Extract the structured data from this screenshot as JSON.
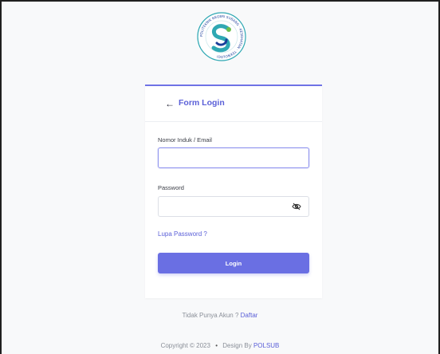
{
  "logo": {
    "ring_text": "POLITEKNIK NEGERI SUBANG · KESEHATAN · TEKNOLOGI",
    "colors": {
      "teal": "#2fa8b3",
      "blue": "#1c3f9b",
      "green": "#6cc04a"
    }
  },
  "form": {
    "title": "Form Login",
    "back_icon": "arrow-left-icon",
    "username_label": "Nomor Induk / Email",
    "username_value": "",
    "password_label": "Password",
    "password_value": "",
    "eye_icon": "eye-off-icon",
    "forgot_link": "Lupa Password ?",
    "login_button": "Login"
  },
  "footer": {
    "register_text": "Tidak Punya Akun ?",
    "register_link": "Daftar",
    "copyright_text": "Copyright © 2023",
    "separator": "•",
    "design_text": "Design By",
    "design_link": "POLSUB"
  },
  "colors": {
    "accent": "#6a6fe3",
    "link": "#5b60d8",
    "background": "#f8f9fa"
  }
}
